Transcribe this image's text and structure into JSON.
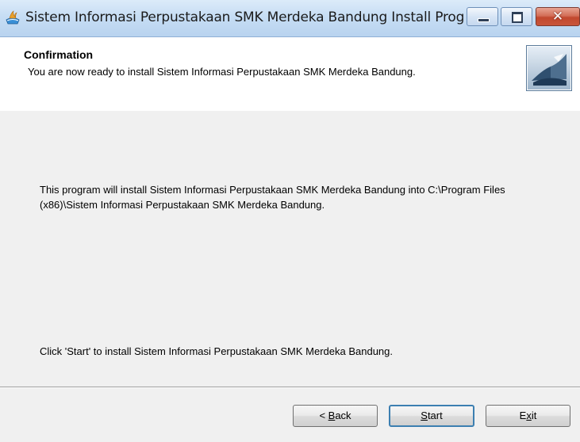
{
  "window": {
    "title": "Sistem Informasi Perpustakaan SMK Merdeka Bandung Install Prog",
    "close_glyph": "✕"
  },
  "header": {
    "title": "Confirmation",
    "subtitle": "You are now ready to install Sistem Informasi Perpustakaan SMK Merdeka Bandung."
  },
  "body": {
    "paragraph1": "This program will install Sistem Informasi Perpustakaan SMK Merdeka Bandung into C:\\Program Files (x86)\\Sistem Informasi Perpustakaan SMK Merdeka Bandung.",
    "paragraph2": "Click 'Start' to install Sistem Informasi Perpustakaan SMK Merdeka Bandung."
  },
  "buttons": {
    "back": {
      "prefix": "< ",
      "mnemonic": "B",
      "rest": "ack"
    },
    "start": {
      "mnemonic": "S",
      "rest": "tart"
    },
    "exit": {
      "prefix": "E",
      "mnemonic": "x",
      "rest": "it"
    }
  },
  "colors": {
    "titlebar": "#c6ddf4",
    "close_button": "#c1482e",
    "default_button_border": "#3c7fb1",
    "dialog_background": "#f0f0f0"
  },
  "icons": {
    "app": "installer-app-icon",
    "header_logo": "setup-logo-icon"
  }
}
